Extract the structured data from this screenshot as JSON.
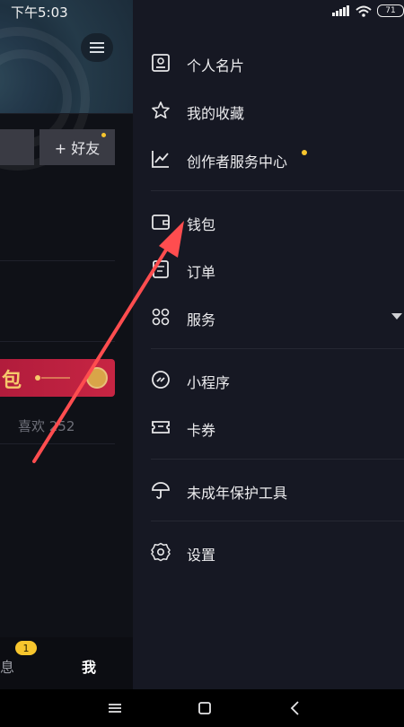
{
  "status_bar": {
    "time": "下午5:03",
    "battery": "71"
  },
  "background_profile": {
    "add_friend_label": "+ 好友",
    "red_packet_char": "包",
    "likes_text": "喜欢 252",
    "bottom_tabs": {
      "messages_label": "消息",
      "messages_badge": "1",
      "me_label": "我"
    }
  },
  "drawer": {
    "items": [
      {
        "label": "个人名片",
        "icon": "id-card-icon"
      },
      {
        "label": "我的收藏",
        "icon": "star-icon"
      },
      {
        "label": "创作者服务中心",
        "icon": "chart-line-icon",
        "new_dot": true
      },
      {
        "label": "钱包",
        "icon": "wallet-icon"
      },
      {
        "label": "订单",
        "icon": "order-icon"
      },
      {
        "label": "服务",
        "icon": "grid-icon",
        "expandable": true
      },
      {
        "label": "小程序",
        "icon": "link-icon"
      },
      {
        "label": "卡券",
        "icon": "ticket-icon"
      },
      {
        "label": "未成年保护工具",
        "icon": "umbrella-icon"
      },
      {
        "label": "设置",
        "icon": "gear-icon"
      }
    ]
  },
  "annotation": {
    "arrow_color": "#ff4d4f",
    "points_to": "钱包"
  },
  "colors": {
    "drawer_bg": "#161823",
    "accent_dot": "#f7c52d",
    "red_packet": "#c72543"
  }
}
